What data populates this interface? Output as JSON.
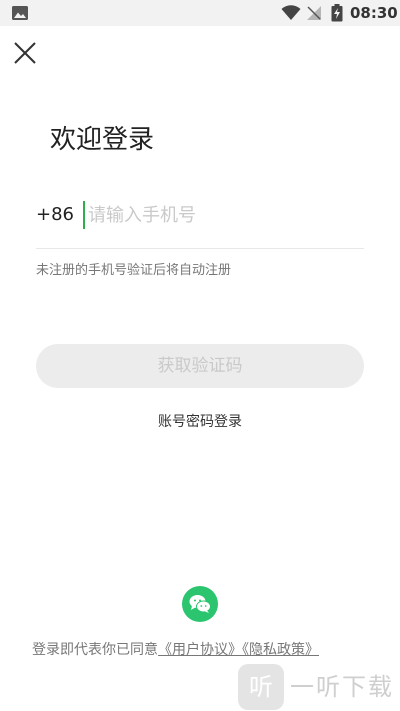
{
  "status_bar": {
    "time": "08:30",
    "icons": [
      "image-icon",
      "wifi-icon",
      "signal-icon",
      "battery-icon"
    ]
  },
  "login": {
    "title": "欢迎登录",
    "country_code": "+86",
    "phone_placeholder": "请输入手机号",
    "phone_value": "",
    "hint": "未注册的手机号验证后将自动注册",
    "get_code_label": "获取验证码",
    "password_login_label": "账号密码登录"
  },
  "agreement": {
    "prefix": "登录即代表你已同意",
    "user_agreement": "《用户协议》",
    "privacy_policy": "《隐私政策》"
  },
  "watermark": {
    "logo_char": "听",
    "text": "一听下载"
  },
  "colors": {
    "accent_green": "#2fae4a",
    "wechat_green": "#2bc46f",
    "button_disabled_bg": "#ececec",
    "button_disabled_text": "#c9c9c9"
  }
}
